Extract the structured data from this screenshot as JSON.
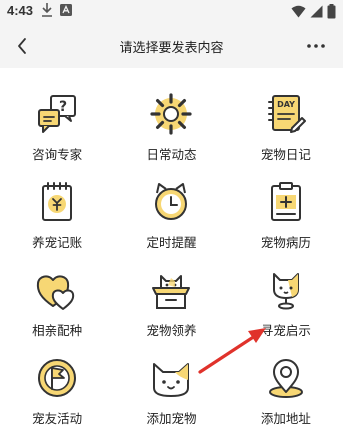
{
  "status_bar": {
    "time": "4:43"
  },
  "nav": {
    "title": "请选择要发表内容"
  },
  "menu": {
    "items": [
      {
        "label": "咨询专家"
      },
      {
        "label": "日常动态"
      },
      {
        "label": "宠物日记"
      },
      {
        "label": "养宠记账"
      },
      {
        "label": "定时提醒"
      },
      {
        "label": "宠物病历"
      },
      {
        "label": "相亲配种"
      },
      {
        "label": "宠物领养"
      },
      {
        "label": "寻宠启示"
      },
      {
        "label": "宠友活动"
      },
      {
        "label": "添加宠物"
      },
      {
        "label": "添加地址"
      }
    ]
  },
  "icons": {
    "diary_badge": "DAY"
  },
  "colors": {
    "accent_yellow": "#f7d774",
    "stroke": "#333333",
    "annotation_arrow": "#e0322b"
  }
}
